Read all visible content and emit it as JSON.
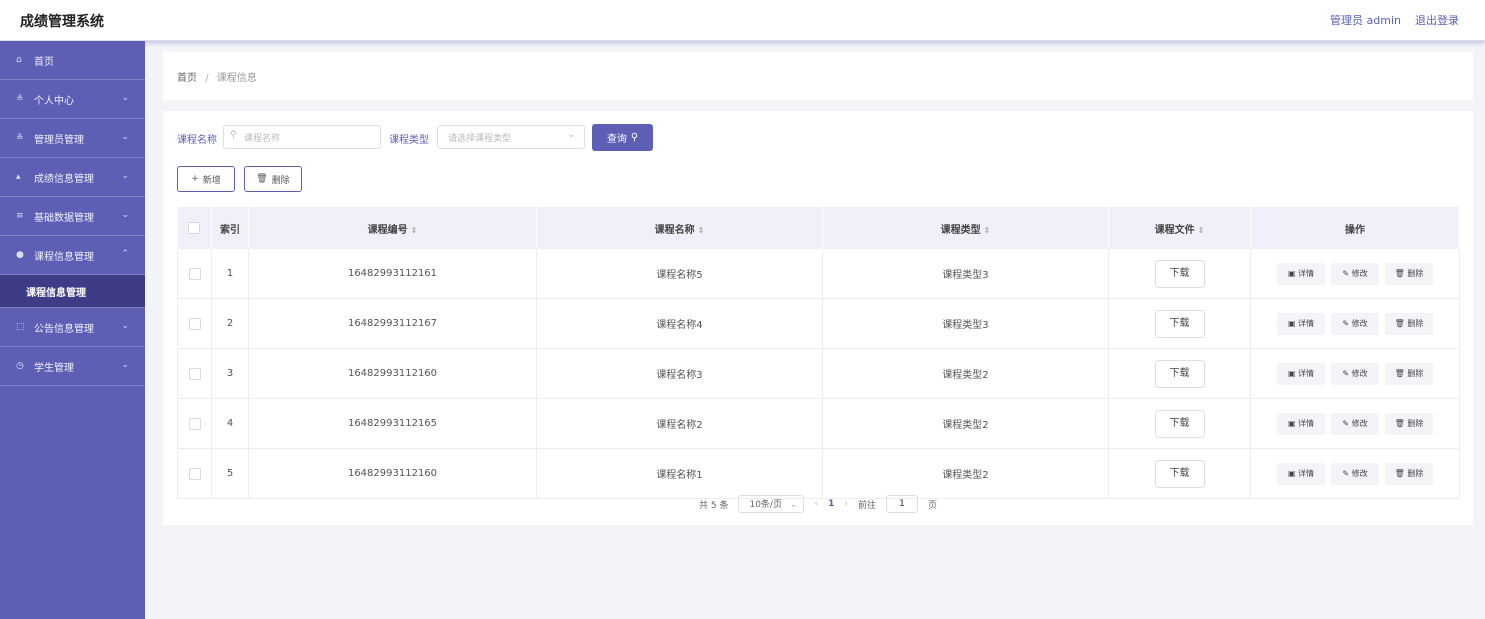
{
  "app": {
    "title": "成绩管理系统",
    "user_label": "管理员 admin",
    "logout_label": "退出登录"
  },
  "sidebar": {
    "items": [
      {
        "label": "首页",
        "icon": "home-icon",
        "glyph": "⌂",
        "chev": ""
      },
      {
        "label": "个人中心",
        "icon": "person-icon",
        "glyph": "≗",
        "chev": "⌄"
      },
      {
        "label": "管理员管理",
        "icon": "person-icon",
        "glyph": "≗",
        "chev": "⌄"
      },
      {
        "label": "成绩信息管理",
        "icon": "chart-icon",
        "glyph": "▴",
        "chev": "⌄"
      },
      {
        "label": "基础数据管理",
        "icon": "data-icon",
        "glyph": "≡",
        "chev": "⌄"
      },
      {
        "label": "课程信息管理",
        "icon": "location-icon",
        "glyph": "●",
        "chev": "⌃"
      },
      {
        "label": "公告信息管理",
        "icon": "grid-icon",
        "glyph": "⬚",
        "chev": "⌄"
      },
      {
        "label": "学生管理",
        "icon": "clock-icon",
        "glyph": "◷",
        "chev": "⌄"
      }
    ],
    "sub_item": "课程信息管理"
  },
  "breadcrumb": {
    "home": "首页",
    "separator": "/",
    "current": "课程信息"
  },
  "search": {
    "name_label": "课程名称",
    "name_placeholder": "课程名称",
    "type_label": "课程类型",
    "type_placeholder": "请选择课程类型",
    "query_button": "查询"
  },
  "actions": {
    "add_label": "新增",
    "delete_label": "删除"
  },
  "table": {
    "headers": {
      "index": "索引",
      "code": "课程编号",
      "name": "课程名称",
      "type": "课程类型",
      "file": "课程文件",
      "ops": "操作"
    },
    "rows": [
      {
        "index": "1",
        "code": "16482993112161",
        "name": "课程名称5",
        "type": "课程类型3"
      },
      {
        "index": "2",
        "code": "16482993112167",
        "name": "课程名称4",
        "type": "课程类型3"
      },
      {
        "index": "3",
        "code": "16482993112160",
        "name": "课程名称3",
        "type": "课程类型2"
      },
      {
        "index": "4",
        "code": "16482993112165",
        "name": "课程名称2",
        "type": "课程类型2"
      },
      {
        "index": "5",
        "code": "16482993112160",
        "name": "课程名称1",
        "type": "课程类型2"
      }
    ],
    "download_label": "下载",
    "ops": {
      "detail": "详情",
      "edit": "修改",
      "delete": "删除"
    }
  },
  "pagination": {
    "total_text": "共 5 条",
    "page_size": "10条/页",
    "current_page": "1",
    "goto_label": "前往",
    "goto_value": "1",
    "page_suffix": "页"
  },
  "colors": {
    "primary": "#5c5fb4",
    "sidebar_active": "#3e3c86"
  }
}
